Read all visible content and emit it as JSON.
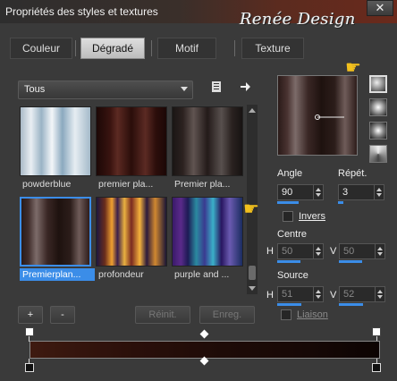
{
  "window": {
    "title": "Propriétés des styles et textures",
    "watermark": "Renée Design",
    "close_symbol": "✕"
  },
  "tabs": [
    {
      "label": "Couleur",
      "active": false
    },
    {
      "label": "Dégradé",
      "active": true
    },
    {
      "label": "Motif",
      "active": false
    },
    {
      "label": "Texture",
      "active": false
    }
  ],
  "category_select": {
    "value": "Tous"
  },
  "gradients": [
    {
      "label": "powderblue",
      "selected": false
    },
    {
      "label": "premier pla...",
      "selected": false
    },
    {
      "label": "Premier pla...",
      "selected": false
    },
    {
      "label": "Premierplan...",
      "selected": true
    },
    {
      "label": "profondeur",
      "selected": false
    },
    {
      "label": "purple and ...",
      "selected": false
    }
  ],
  "angle": {
    "label": "Angle",
    "value": "90"
  },
  "repeat": {
    "label": "Répét.",
    "value": "3"
  },
  "invert": {
    "label": "Invers",
    "checked": false
  },
  "center": {
    "label": "Centre",
    "h_label": "H",
    "h_value": "50",
    "v_label": "V",
    "v_value": "50"
  },
  "source": {
    "label": "Source",
    "h_label": "H",
    "h_value": "51",
    "v_label": "V",
    "v_value": "52"
  },
  "link": {
    "label": "Liaison",
    "checked": false
  },
  "buttons": {
    "add": "+",
    "remove": "-",
    "reset": "Réinit.",
    "save": "Enreg."
  },
  "colors": {
    "accent": "#3b8de8",
    "titlebar_end": "#6a2a1c",
    "pointer": "#f2c01d"
  }
}
